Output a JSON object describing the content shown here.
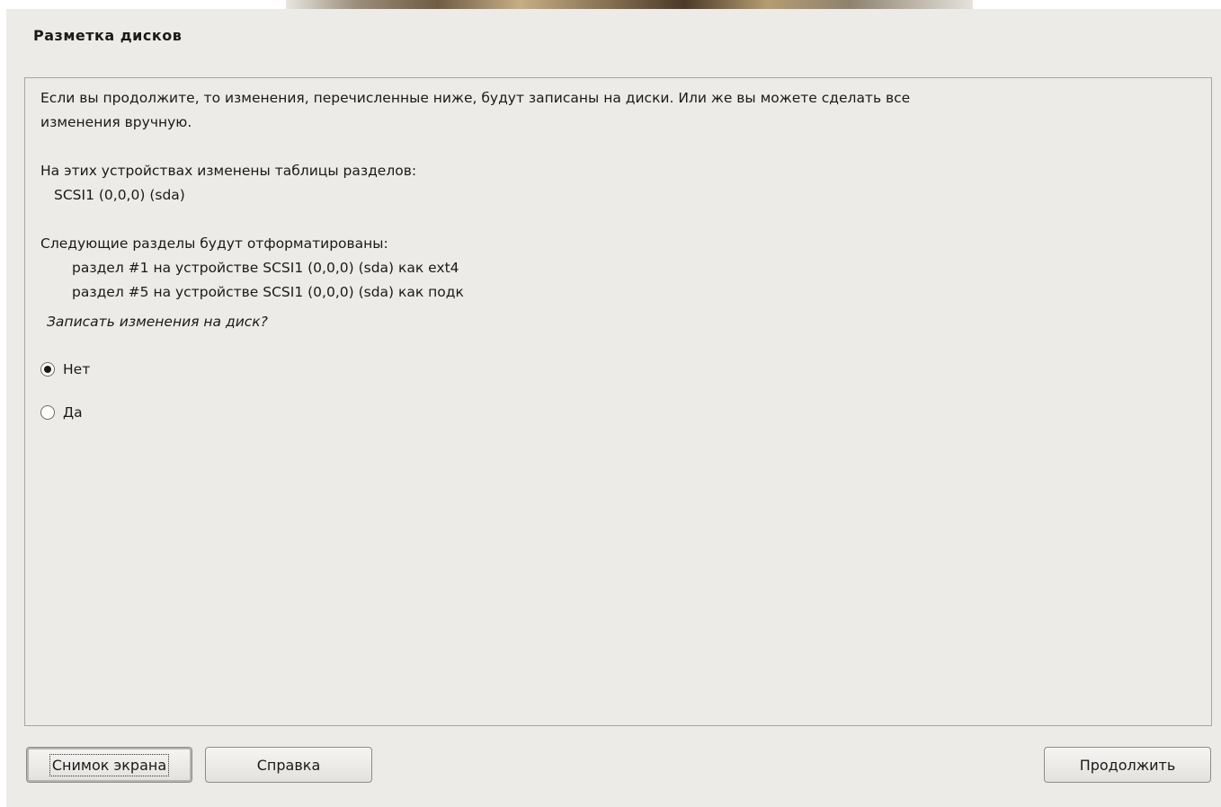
{
  "dialog": {
    "title": "Разметка дисков",
    "intro_line1": "Если вы продолжите, то изменения, перечисленные ниже, будут записаны на диски. Или же вы можете сделать все",
    "intro_line2": "изменения вручную.",
    "tables_header": "На этих устройствах изменены таблицы разделов:",
    "tables_device": "SCSI1 (0,0,0) (sda)",
    "format_header": "Следующие разделы будут отформатированы:",
    "format_items": [
      "раздел #1 на устройстве SCSI1 (0,0,0) (sda) как ext4",
      "раздел #5 на устройстве SCSI1 (0,0,0) (sda) как подк"
    ],
    "question": "Записать изменения на диск?",
    "options": [
      {
        "label": "Нет",
        "selected": true
      },
      {
        "label": "Да",
        "selected": false
      }
    ]
  },
  "buttons": {
    "screenshot": "Снимок экрана",
    "help": "Справка",
    "continue": "Продолжить"
  }
}
